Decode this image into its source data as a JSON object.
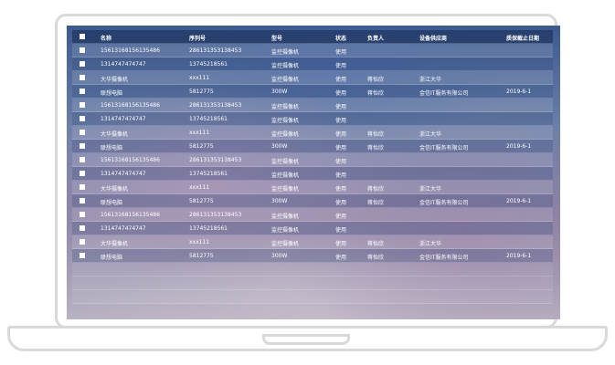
{
  "table": {
    "headers": {
      "name": "名称",
      "serial": "序列号",
      "model": "型号",
      "status": "状态",
      "owner": "负责人",
      "vendor": "设备供应商",
      "warranty": "质保截止日期"
    },
    "rows": [
      {
        "name": "15613168156135486",
        "serial": "286131353138453",
        "model": "监控摄像机",
        "status": "使用",
        "owner": "",
        "vendor": "",
        "warranty": ""
      },
      {
        "name": "1314747474747",
        "serial": "13745218561",
        "model": "监控摄像机",
        "status": "使用",
        "owner": "",
        "vendor": "",
        "warranty": ""
      },
      {
        "name": "大华摄像机",
        "serial": "xxx111",
        "model": "监控摄像机",
        "status": "使用",
        "owner": "蒋怡欣",
        "vendor": "浙江大华",
        "warranty": ""
      },
      {
        "name": "联想电脑",
        "serial": "5812775",
        "model": "300W",
        "status": "使用",
        "owner": "蒋怡欣",
        "vendor": "金信IT服务有限公司",
        "warranty": "2019-6-1"
      },
      {
        "name": "15613168156135486",
        "serial": "286131353138453",
        "model": "监控摄像机",
        "status": "使用",
        "owner": "",
        "vendor": "",
        "warranty": ""
      },
      {
        "name": "1314747474747",
        "serial": "13745218561",
        "model": "监控摄像机",
        "status": "使用",
        "owner": "",
        "vendor": "",
        "warranty": ""
      },
      {
        "name": "大华摄像机",
        "serial": "xxx111",
        "model": "监控摄像机",
        "status": "使用",
        "owner": "蒋怡欣",
        "vendor": "浙江大华",
        "warranty": ""
      },
      {
        "name": "联想电脑",
        "serial": "5812775",
        "model": "300W",
        "status": "使用",
        "owner": "蒋怡欣",
        "vendor": "金信IT服务有限公司",
        "warranty": "2019-6-1"
      },
      {
        "name": "15613168156135486",
        "serial": "286131353138453",
        "model": "监控摄像机",
        "status": "使用",
        "owner": "",
        "vendor": "",
        "warranty": ""
      },
      {
        "name": "1314747474747",
        "serial": "13745218561",
        "model": "监控摄像机",
        "status": "使用",
        "owner": "",
        "vendor": "",
        "warranty": ""
      },
      {
        "name": "大华摄像机",
        "serial": "xxx111",
        "model": "监控摄像机",
        "status": "使用",
        "owner": "蒋怡欣",
        "vendor": "浙江大华",
        "warranty": ""
      },
      {
        "name": "联想电脑",
        "serial": "5812775",
        "model": "300W",
        "status": "使用",
        "owner": "蒋怡欣",
        "vendor": "金信IT服务有限公司",
        "warranty": "2019-6-1"
      },
      {
        "name": "15613168156135486",
        "serial": "286131353138453",
        "model": "监控摄像机",
        "status": "使用",
        "owner": "",
        "vendor": "",
        "warranty": ""
      },
      {
        "name": "1314747474747",
        "serial": "13745218561",
        "model": "监控摄像机",
        "status": "使用",
        "owner": "",
        "vendor": "",
        "warranty": ""
      },
      {
        "name": "大华摄像机",
        "serial": "xxx111",
        "model": "监控摄像机",
        "status": "使用",
        "owner": "蒋怡欣",
        "vendor": "浙江大华",
        "warranty": ""
      },
      {
        "name": "联想电脑",
        "serial": "5812775",
        "model": "300W",
        "status": "使用",
        "owner": "蒋怡欣",
        "vendor": "金信IT服务有限公司",
        "warranty": "2019-6-1"
      }
    ]
  }
}
